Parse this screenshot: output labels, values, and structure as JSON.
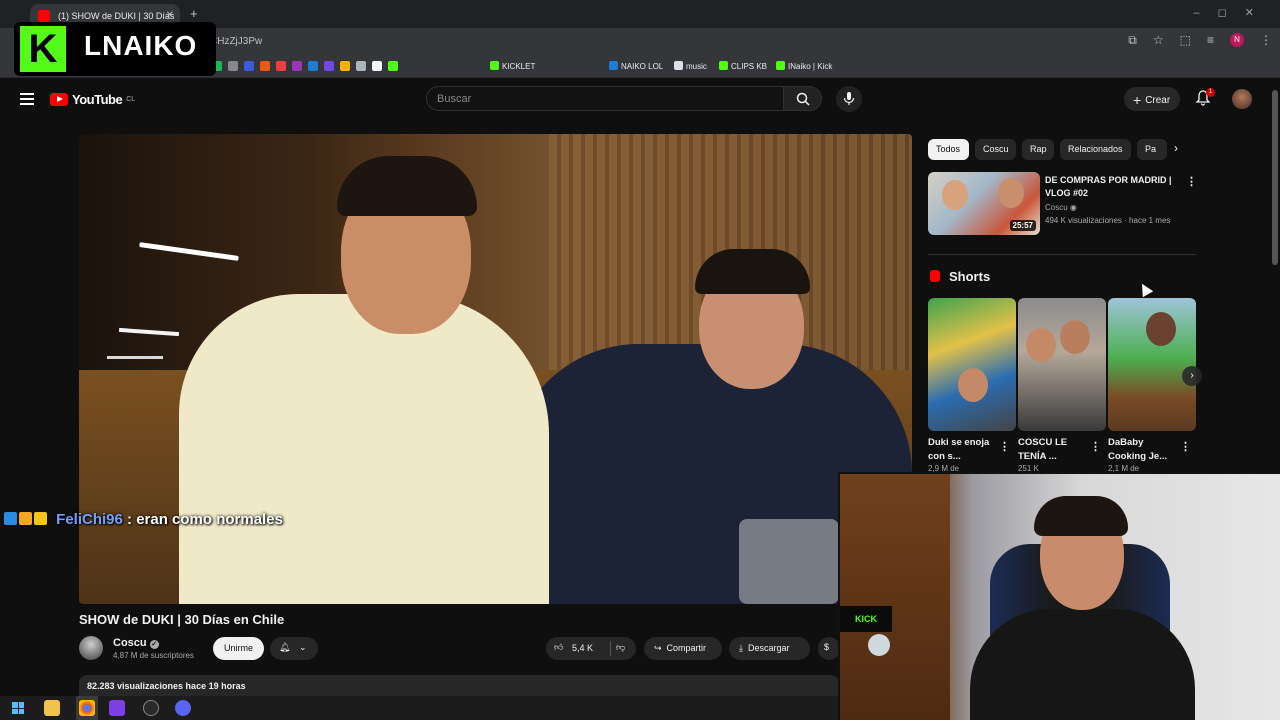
{
  "browser": {
    "tab_title": "(1) SHOW de DUKI | 30 Días",
    "url": "CHzZjJ3Pw",
    "bookmarks": [
      "KICKLET",
      "NAIKO LOL",
      "music",
      "CLIPS KB",
      "INaiko | Kick"
    ]
  },
  "overlay": {
    "logo_letter": "K",
    "logo_text": "LNAIKO"
  },
  "youtube": {
    "logo_text": "YouTube",
    "logo_suffix": "CL",
    "search_placeholder": "Buscar",
    "create_label": "Crear",
    "notification_count": "1"
  },
  "video": {
    "title": "SHOW de DUKI | 30 Días en Chile",
    "channel": "Coscu",
    "subscribers": "4,87 M de suscriptores",
    "join_label": "Unirme",
    "likes": "5,4 K",
    "share_label": "Compartir",
    "download_label": "Descargar",
    "views_line": "82.283 visualizaciones  hace 19 horas"
  },
  "chat": {
    "username": "FeliChi96",
    "message": ": eran como normales"
  },
  "sidebar": {
    "chips": [
      "Todos",
      "Coscu",
      "Rap",
      "Relacionados",
      "Pa"
    ],
    "related": {
      "title": "DE COMPRAS POR MADRID | VLOG #02",
      "channel": "Coscu",
      "meta": "494 K visualizaciones · hace 1 mes",
      "duration": "25:57"
    },
    "shorts_heading": "Shorts",
    "shorts": [
      {
        "title": "Duki se enoja con s...",
        "meta": "2,9 M de"
      },
      {
        "title": "COSCU LE TENÍA ...",
        "meta": "251 K"
      },
      {
        "title": "DaBaby Cooking Je...",
        "meta": "2,1 M de"
      }
    ]
  },
  "webcam": {
    "sign_text": "KICK"
  },
  "colors": {
    "youtube_red": "#ff0000",
    "kick_green": "#53fc18",
    "background": "#0f0f0f",
    "chat_username": "#6ea0ff"
  }
}
